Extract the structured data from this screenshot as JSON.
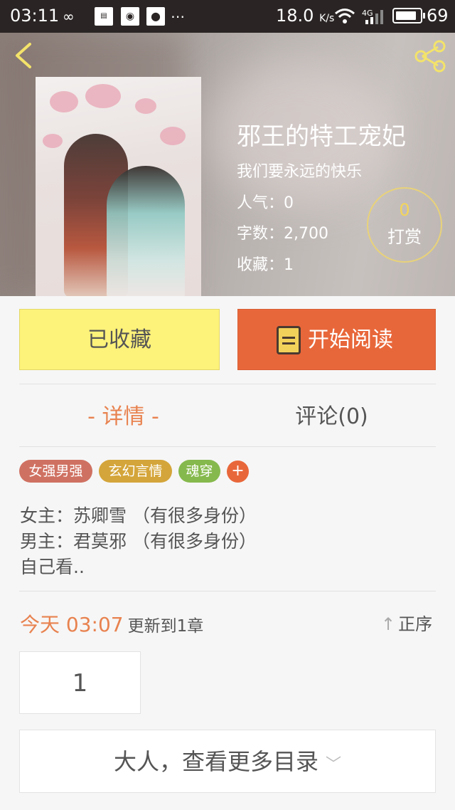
{
  "status_bar": {
    "time": "03:11",
    "speed": "18.0",
    "speed_unit": "K/s",
    "network": "4G",
    "battery": "69",
    "notif_icons": [
      "infinity-icon",
      "news-icon",
      "radio-icon",
      "paw-icon",
      "more-icon"
    ]
  },
  "book": {
    "title": "邪王的特工宠妃",
    "author": "我们要永远的快乐",
    "popularity": "人气：0",
    "word_count": "字数：2,700",
    "favorites": "收藏：1",
    "tip_count": "0",
    "tip_label": "打赏"
  },
  "actions": {
    "favorited_label": "已收藏",
    "read_label": "开始阅读"
  },
  "tabs": {
    "detail": "- 详情 -",
    "comments": "评论(0)"
  },
  "tags": [
    {
      "label": "女强男强",
      "color": "#cf7162"
    },
    {
      "label": "玄幻言情",
      "color": "#d4a53a"
    },
    {
      "label": "魂穿",
      "color": "#86b94d"
    }
  ],
  "tag_add": "+",
  "description": {
    "line1": "女主：苏卿雪 （有很多身份）",
    "line2": "男主：君莫邪 （有很多身份）",
    "line3": "自己看.."
  },
  "update": {
    "time": "今天 03:07",
    "text": "更新到1章"
  },
  "sort_label": "正序",
  "chapter_number": "1",
  "more_catalog": "大人，查看更多目录",
  "colors": {
    "accent_orange": "#e8673a",
    "favorite_yellow": "#fdf27a",
    "detail_tab": "#e8824f"
  }
}
